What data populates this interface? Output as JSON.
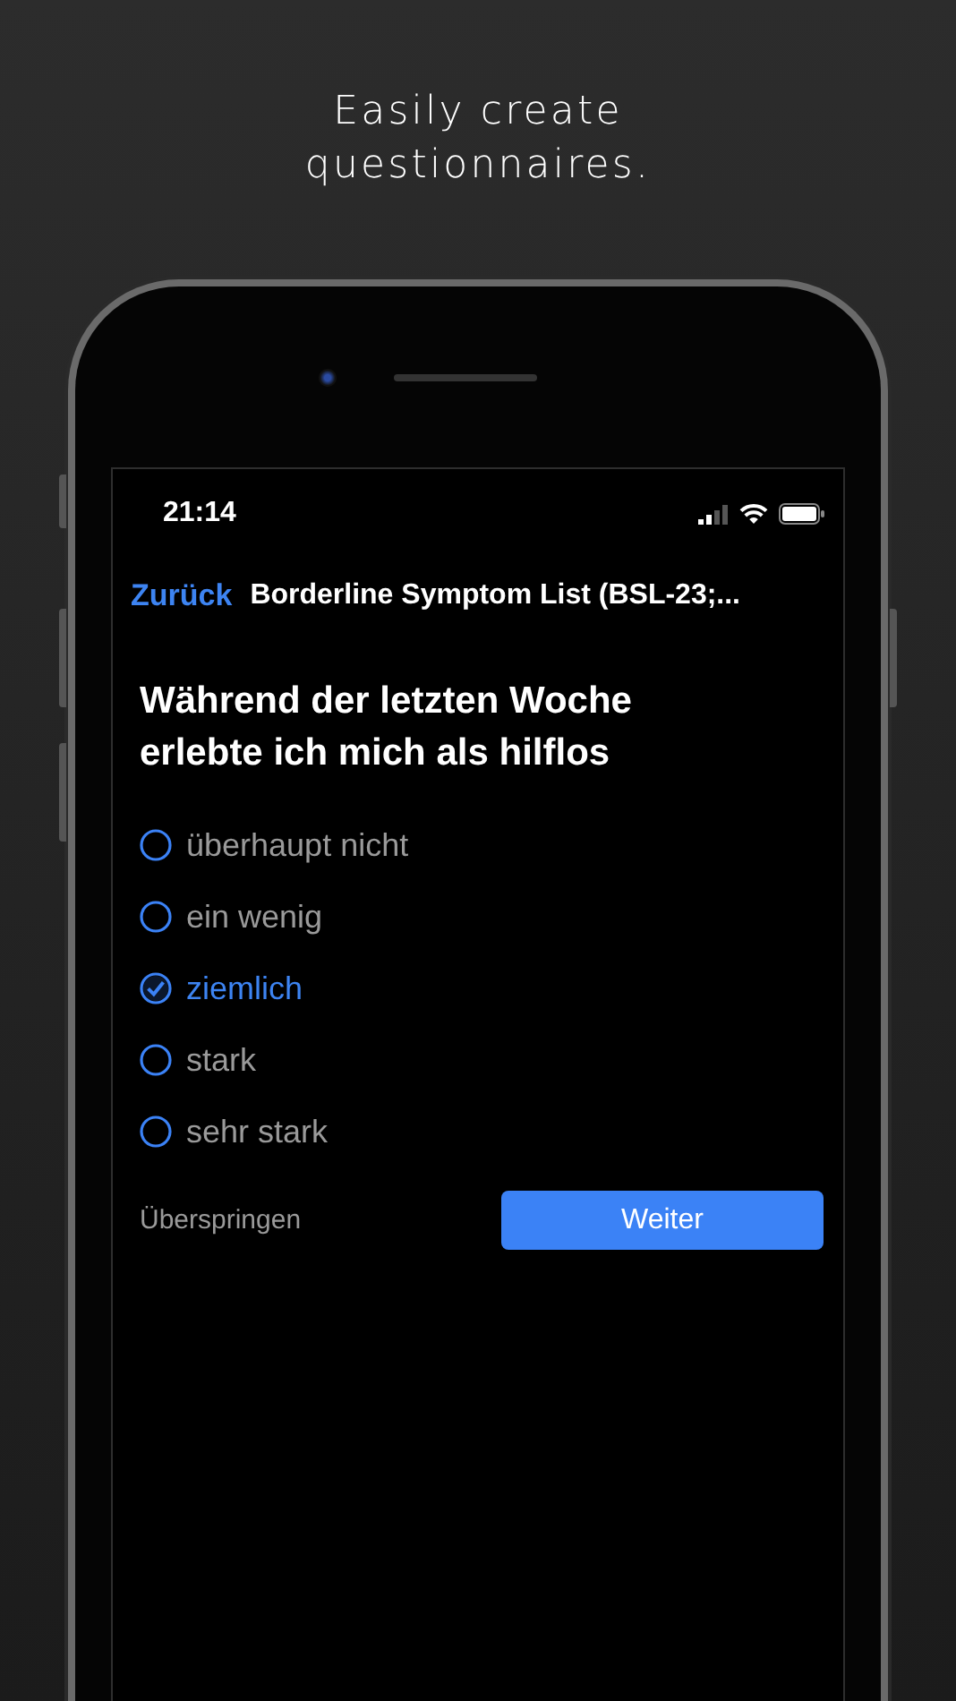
{
  "headline": "Easily create\nquestionnaires.",
  "status_bar": {
    "time": "21:14"
  },
  "nav": {
    "back": "Zurück",
    "title": "Borderline Symptom List (BSL-23;..."
  },
  "question": "Während der letzten Woche erlebte ich mich als hilflos",
  "options": [
    {
      "label": "überhaupt nicht",
      "selected": false
    },
    {
      "label": "ein wenig",
      "selected": false
    },
    {
      "label": "ziemlich",
      "selected": true
    },
    {
      "label": "stark",
      "selected": false
    },
    {
      "label": "sehr stark",
      "selected": false
    }
  ],
  "skip": "Überspringen",
  "next": "Weiter"
}
